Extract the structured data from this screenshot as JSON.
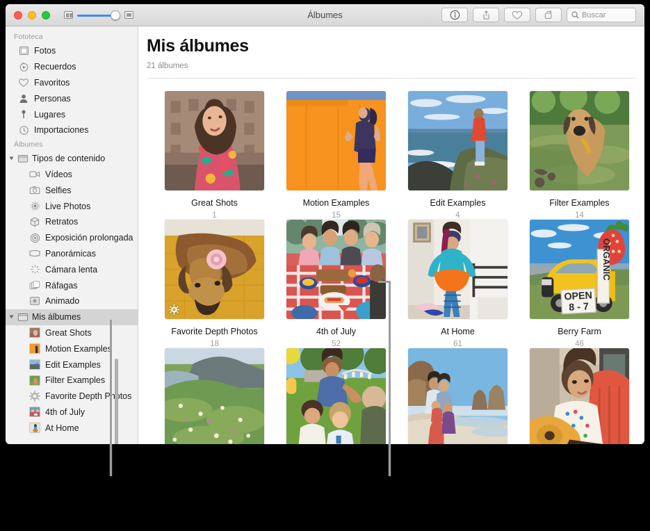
{
  "window": {
    "title": "Álbumes",
    "traffic_lights": [
      "close",
      "minimize",
      "zoom"
    ],
    "zoom_slider": {
      "min_icon": "thumbnail-small-icon",
      "max_icon": "thumbnail-large-icon",
      "value_percent": 78
    }
  },
  "toolbar": {
    "buttons": [
      {
        "name": "info-button",
        "icon": "info-icon",
        "label": ""
      },
      {
        "name": "share-button",
        "icon": "share-icon",
        "label": ""
      },
      {
        "name": "favorite-button",
        "icon": "heart-icon",
        "label": ""
      },
      {
        "name": "rotate-button",
        "icon": "rotate-icon",
        "label": ""
      }
    ],
    "search": {
      "placeholder": "Buscar",
      "value": ""
    }
  },
  "sidebar": {
    "sections": [
      {
        "header": "Fototeca",
        "items": [
          {
            "label": "Fotos",
            "icon": "photos-icon",
            "selected": false
          },
          {
            "label": "Recuerdos",
            "icon": "memories-icon",
            "selected": false
          },
          {
            "label": "Favoritos",
            "icon": "heart-icon",
            "selected": false
          },
          {
            "label": "Personas",
            "icon": "person-icon",
            "selected": false
          },
          {
            "label": "Lugares",
            "icon": "pin-icon",
            "selected": false
          },
          {
            "label": "Importaciones",
            "icon": "clock-icon",
            "selected": false
          }
        ]
      },
      {
        "header": "Álbumes",
        "groups": [
          {
            "label": "Tipos de contenido",
            "icon": "folder-icon",
            "expanded": true,
            "selected": false,
            "items": [
              {
                "label": "Vídeos",
                "icon": "video-icon"
              },
              {
                "label": "Selfies",
                "icon": "camera-icon"
              },
              {
                "label": "Live Photos",
                "icon": "live-photo-icon"
              },
              {
                "label": "Retratos",
                "icon": "cube-icon"
              },
              {
                "label": "Exposición prolongada",
                "icon": "long-exposure-icon"
              },
              {
                "label": "Panorámicas",
                "icon": "panorama-icon"
              },
              {
                "label": "Cámara lenta",
                "icon": "slow-motion-icon"
              },
              {
                "label": "Ráfagas",
                "icon": "burst-icon"
              },
              {
                "label": "Animado",
                "icon": "animated-icon"
              }
            ]
          },
          {
            "label": "Mis álbumes",
            "icon": "folder-icon",
            "expanded": true,
            "selected": true,
            "items": [
              {
                "label": "Great Shots",
                "icon": "album-thumb"
              },
              {
                "label": "Motion Examples",
                "icon": "album-thumb"
              },
              {
                "label": "Edit Examples",
                "icon": "album-thumb"
              },
              {
                "label": "Filter Examples",
                "icon": "album-thumb"
              },
              {
                "label": "Favorite Depth Photos",
                "icon": "gear-icon"
              },
              {
                "label": "4th of July",
                "icon": "album-thumb"
              },
              {
                "label": "At Home",
                "icon": "album-thumb"
              }
            ]
          }
        ]
      }
    ]
  },
  "main": {
    "title": "Mis álbumes",
    "subtitle": "21 álbumes",
    "albums": [
      {
        "name": "Great Shots",
        "count": "1",
        "art": "woman-floral-brick",
        "badge": null
      },
      {
        "name": "Motion Examples",
        "count": "15",
        "art": "orange-wall-runner",
        "badge": null
      },
      {
        "name": "Edit Examples",
        "count": "4",
        "art": "coastal-cliff-red-jacket",
        "badge": null
      },
      {
        "name": "Filter Examples",
        "count": "14",
        "art": "dog-in-river",
        "badge": null
      },
      {
        "name": "Favorite Depth Photos",
        "count": "18",
        "art": "dog-flower-yellow-blanket",
        "badge": "depth-effect-icon"
      },
      {
        "name": "4th of July",
        "count": "52",
        "art": "picnic-table-family",
        "badge": null
      },
      {
        "name": "At Home",
        "count": "61",
        "art": "girl-orange-tutu",
        "badge": null
      },
      {
        "name": "Berry Farm",
        "count": "46",
        "art": "yellow-truck-strawberry",
        "badge": null
      },
      {
        "name": "",
        "count": "",
        "art": "coastal-wildflowers",
        "badge": null
      },
      {
        "name": "",
        "count": "",
        "art": "birthday-party",
        "badge": null
      },
      {
        "name": "",
        "count": "",
        "art": "family-beach-cliffs",
        "badge": null
      },
      {
        "name": "",
        "count": "",
        "art": "girl-with-guitar",
        "badge": null
      }
    ]
  },
  "callouts": [
    {
      "name": "callout-line-sidebar",
      "points_to": "sidebar-my-albums-list"
    },
    {
      "name": "callout-line-grid",
      "points_to": "album-tile-4th-of-july"
    }
  ],
  "colors": {
    "accent_blue": "#3d8bfd",
    "sidebar_bg": "#f2f2f2",
    "selection_gray": "#d4d4d4",
    "callout_gray": "#9d9d9d",
    "muted_text": "#a0a0a0"
  }
}
